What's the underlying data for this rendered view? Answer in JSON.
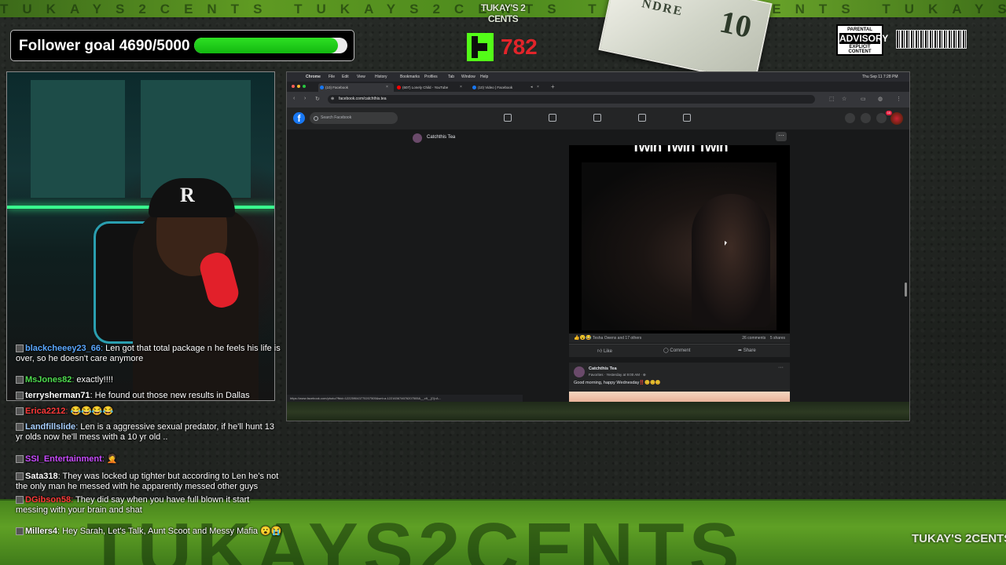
{
  "overlay": {
    "brand_top": "TUKAY'S 2 CENTS",
    "brand_bottom": "TUKAY'S 2CENTS",
    "bottom_banner_text": "TUKAYS2CENTS",
    "follower_goal": {
      "label": "Follower goal 4690/5000",
      "current": 4690,
      "target": 5000,
      "progress": 0.938
    },
    "kick": {
      "count": "782"
    },
    "money_number": "10",
    "money_text": "NDRE",
    "advisory": {
      "line1": "PARENTAL",
      "line2": "ADVISORY",
      "line3": "EXPLICIT CONTENT"
    }
  },
  "chat": [
    {
      "user": "blackcheeey23_66",
      "text": " Len got that total package n he feels his life is over, so he doesn't care anymore",
      "color": "#5aa8ff"
    },
    {
      "user": "MsJones82",
      "text": " exactly!!!!",
      "color": "#4fdc4f"
    },
    {
      "user": "terrysherman71",
      "text": " He found out those new results in Dallas",
      "color": "#ffffff"
    },
    {
      "user": "Erica2212",
      "text": " 😂😂😂😂",
      "color": "#ff3a3a"
    },
    {
      "user": "Landfillslide",
      "text": " Len is a aggressive sexual predator, if he'll hunt 13 yr olds now he'll mess with a 10 yr old ..",
      "color": "#a8d0ff"
    },
    {
      "user": "SSI_Entertainment",
      "text": " 🤦",
      "color": "#c94cff"
    },
    {
      "user": "Sata318",
      "text": " They was locked up tighter but according to Len he's not the only man he messed with he apparently messed other guys",
      "color": "#ffffff"
    },
    {
      "user": "DGibson58",
      "text": " They did say when you have full blown it start messing with your brain and shat",
      "color": "#ff3a3a"
    },
    {
      "user": "Millers4",
      "text": " Hey Sarah, Let's Talk, Aunt Scoot and Messy Mafia 😮😭",
      "color": "#ffffff"
    }
  ],
  "browser": {
    "app_name": "Chrome",
    "menu_items": [
      "File",
      "Edit",
      "View",
      "History",
      "Bookmarks",
      "Profiles",
      "Tab",
      "Window",
      "Help"
    ],
    "clock": "Thu Sep 11 7:28 PM",
    "tabs": [
      {
        "label": "(10) Facebook",
        "color": "#1877f2"
      },
      {
        "label": "(607) Lonely Child - YouTube",
        "color": "#ff0000"
      },
      {
        "label": "(10) Video | Facebook",
        "color": "#1877f2"
      }
    ],
    "url": "facebook.com/catchthis.tea",
    "status_url": "https://www.facebook.com/photo/?fbid=122259043770207505&set=a.122163674676207505&__cft__[0]=A..."
  },
  "facebook": {
    "search_placeholder": "Search Facebook",
    "notification_count": "10",
    "page_name": "Catchthis Tea",
    "post": {
      "video_caption": "Twin Twin Twin",
      "reactions_icons": "👍😮😂",
      "reactions_text": "Tesha Owens and 17 others",
      "comments": "26 comments",
      "shares": "5 shares",
      "actions": {
        "like": "Like",
        "comment": "Comment",
        "share": "Share"
      }
    },
    "next_post": {
      "name": "Catchthis Tea",
      "meta": "Favorites · Yesterday at 9:00 AM · ⊕",
      "text": "Good morning, happy Wednesday‼️😊😊😊"
    }
  }
}
